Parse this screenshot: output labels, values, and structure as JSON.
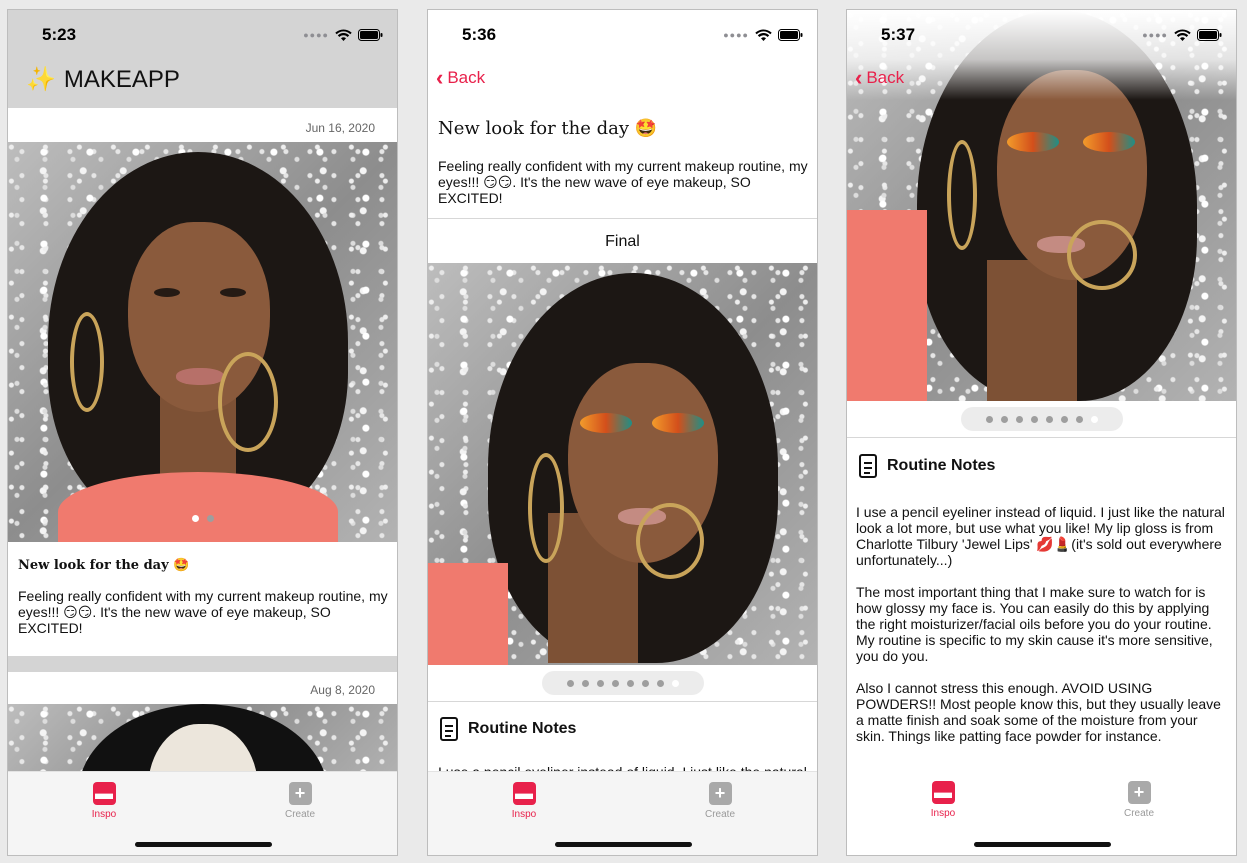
{
  "status": {
    "time_left": "5:23",
    "time_middle": "5:36",
    "time_right": "5:37",
    "signal_icon": "signal-dots-icon",
    "wifi_icon": "wifi-icon",
    "battery_icon": "battery-icon"
  },
  "app": {
    "brand_name": "MAKEAPP",
    "brand_icon": "magic-wand-icon"
  },
  "feed": {
    "posts": [
      {
        "date": "Jun 16, 2020",
        "title": "New look for the day 🤩",
        "body": "Feeling really confident with my current makeup routine, my eyes!!! 😏😏. It's the new wave of eye makeup, SO EXCITED!",
        "page_count": 2,
        "active_page": 1
      },
      {
        "date": "Aug 8, 2020"
      }
    ]
  },
  "detail": {
    "back_label": "Back",
    "title": "New look for the day 🤩",
    "body": "Feeling really confident with my current makeup routine, my eyes!!! 😏😏. It's the new wave of eye makeup, SO EXCITED!",
    "image_caption": "Final",
    "page_count": 8,
    "active_page": 8,
    "notes_heading": "Routine Notes",
    "notes_icon": "document-icon",
    "notes_partial": "I use a pencil eyeliner instead of liquid. I just like the natural",
    "notes": [
      "I use a pencil eyeliner instead of liquid. I just like the natural look a lot more, but use what you like! My lip gloss is from Charlotte Tilbury 'Jewel Lips' 💋💄(it's sold out everywhere unfortunately...)",
      "The most important thing that I make sure to watch for is how glossy my face is. You can easily do this by applying the right moisturizer/facial oils before you do your routine. My routine is specific to my skin cause it's more sensitive, you do you.",
      "Also I cannot stress this enough. AVOID USING POWDERS!! Most people know this, but they usually leave a matte finish and soak some of the moisture from your skin. Things like patting face powder for instance."
    ]
  },
  "tabs": [
    {
      "label": "Inspo",
      "icon": "inspo-icon",
      "active": true,
      "color": "#e8214b"
    },
    {
      "label": "Create",
      "icon": "plus-icon",
      "active": false,
      "color": "#9a9a9a"
    }
  ],
  "colors": {
    "accent": "#e8214b",
    "header_bg": "#d4d4d4"
  }
}
